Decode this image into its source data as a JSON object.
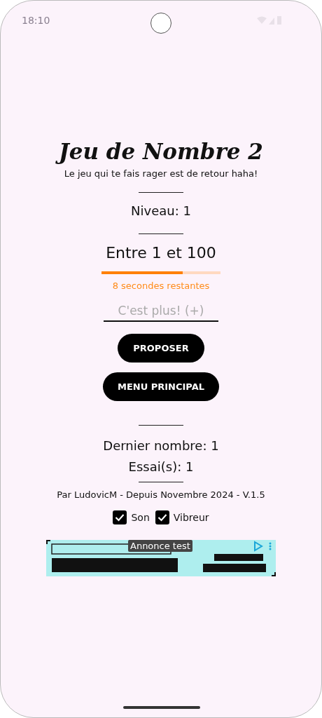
{
  "status_bar": {
    "time": "18:10"
  },
  "title": "Jeu de Nombre 2",
  "subtitle": "Le jeu qui te fais rager est de retour haha!",
  "level_label": "Niveau: 1",
  "range_label": "Entre 1 et 100",
  "timer": {
    "level": 0.68,
    "text": "8 secondes restantes"
  },
  "guess_field": {
    "placeholder": "C'est plus! (+)"
  },
  "buttons": [
    {
      "label": "PROPOSER"
    },
    {
      "label": "MENU PRINCIPAL"
    }
  ],
  "last_number": "Dernier nombre: 1",
  "attempts": "Essai(s): 1",
  "credits": "Par LudovicM - Depuis Novembre 2024 - V.1.5",
  "options": [
    {
      "label": "Son",
      "checked": true
    },
    {
      "label": "Vibreur",
      "checked": true
    }
  ],
  "ad": {
    "kind": "picture",
    "label": "Annonce test"
  }
}
